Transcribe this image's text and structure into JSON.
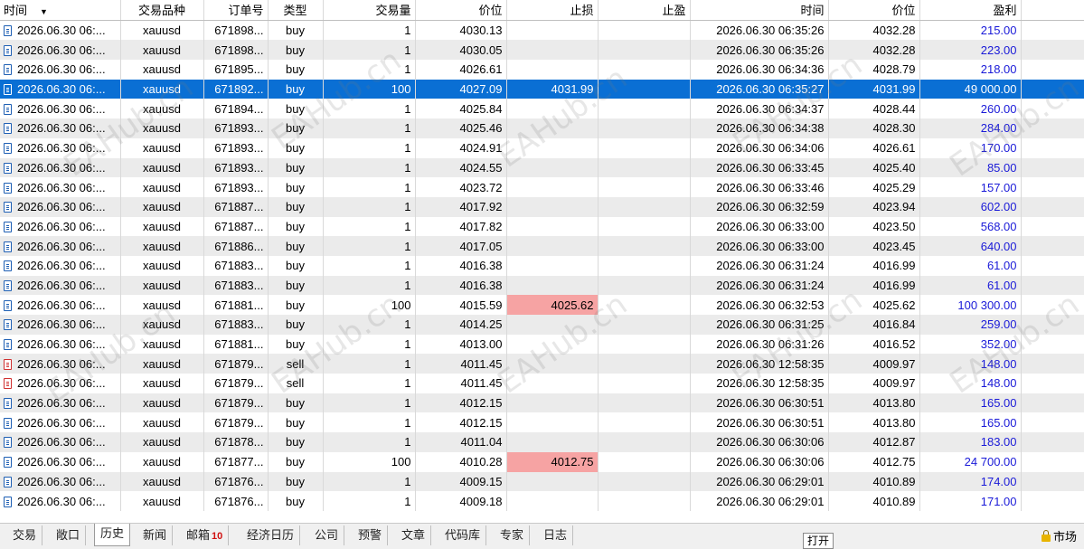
{
  "columns": [
    "时间",
    "交易品种",
    "订单号",
    "类型",
    "交易量",
    "价位",
    "止损",
    "止盈",
    "时间",
    "价位",
    "盈利"
  ],
  "rows": [
    {
      "open_time": "2026.06.30 06:...",
      "symbol": "xauusd",
      "order": "671898...",
      "type": "buy",
      "volume": "1",
      "price": "4030.13",
      "sl": "",
      "tp": "",
      "close_time": "2026.06.30 06:35:26",
      "close_price": "4032.28",
      "profit": "215.00"
    },
    {
      "open_time": "2026.06.30 06:...",
      "symbol": "xauusd",
      "order": "671898...",
      "type": "buy",
      "volume": "1",
      "price": "4030.05",
      "sl": "",
      "tp": "",
      "close_time": "2026.06.30 06:35:26",
      "close_price": "4032.28",
      "profit": "223.00"
    },
    {
      "open_time": "2026.06.30 06:...",
      "symbol": "xauusd",
      "order": "671895...",
      "type": "buy",
      "volume": "1",
      "price": "4026.61",
      "sl": "",
      "tp": "",
      "close_time": "2026.06.30 06:34:36",
      "close_price": "4028.79",
      "profit": "218.00"
    },
    {
      "open_time": "2026.06.30 06:...",
      "symbol": "xauusd",
      "order": "671892...",
      "type": "buy",
      "volume": "100",
      "price": "4027.09",
      "sl": "4031.99",
      "tp": "",
      "close_time": "2026.06.30 06:35:27",
      "close_price": "4031.99",
      "profit": "49 000.00",
      "selected": true
    },
    {
      "open_time": "2026.06.30 06:...",
      "symbol": "xauusd",
      "order": "671894...",
      "type": "buy",
      "volume": "1",
      "price": "4025.84",
      "sl": "",
      "tp": "",
      "close_time": "2026.06.30 06:34:37",
      "close_price": "4028.44",
      "profit": "260.00"
    },
    {
      "open_time": "2026.06.30 06:...",
      "symbol": "xauusd",
      "order": "671893...",
      "type": "buy",
      "volume": "1",
      "price": "4025.46",
      "sl": "",
      "tp": "",
      "close_time": "2026.06.30 06:34:38",
      "close_price": "4028.30",
      "profit": "284.00"
    },
    {
      "open_time": "2026.06.30 06:...",
      "symbol": "xauusd",
      "order": "671893...",
      "type": "buy",
      "volume": "1",
      "price": "4024.91",
      "sl": "",
      "tp": "",
      "close_time": "2026.06.30 06:34:06",
      "close_price": "4026.61",
      "profit": "170.00"
    },
    {
      "open_time": "2026.06.30 06:...",
      "symbol": "xauusd",
      "order": "671893...",
      "type": "buy",
      "volume": "1",
      "price": "4024.55",
      "sl": "",
      "tp": "",
      "close_time": "2026.06.30 06:33:45",
      "close_price": "4025.40",
      "profit": "85.00"
    },
    {
      "open_time": "2026.06.30 06:...",
      "symbol": "xauusd",
      "order": "671893...",
      "type": "buy",
      "volume": "1",
      "price": "4023.72",
      "sl": "",
      "tp": "",
      "close_time": "2026.06.30 06:33:46",
      "close_price": "4025.29",
      "profit": "157.00"
    },
    {
      "open_time": "2026.06.30 06:...",
      "symbol": "xauusd",
      "order": "671887...",
      "type": "buy",
      "volume": "1",
      "price": "4017.92",
      "sl": "",
      "tp": "",
      "close_time": "2026.06.30 06:32:59",
      "close_price": "4023.94",
      "profit": "602.00"
    },
    {
      "open_time": "2026.06.30 06:...",
      "symbol": "xauusd",
      "order": "671887...",
      "type": "buy",
      "volume": "1",
      "price": "4017.82",
      "sl": "",
      "tp": "",
      "close_time": "2026.06.30 06:33:00",
      "close_price": "4023.50",
      "profit": "568.00"
    },
    {
      "open_time": "2026.06.30 06:...",
      "symbol": "xauusd",
      "order": "671886...",
      "type": "buy",
      "volume": "1",
      "price": "4017.05",
      "sl": "",
      "tp": "",
      "close_time": "2026.06.30 06:33:00",
      "close_price": "4023.45",
      "profit": "640.00"
    },
    {
      "open_time": "2026.06.30 06:...",
      "symbol": "xauusd",
      "order": "671883...",
      "type": "buy",
      "volume": "1",
      "price": "4016.38",
      "sl": "",
      "tp": "",
      "close_time": "2026.06.30 06:31:24",
      "close_price": "4016.99",
      "profit": "61.00"
    },
    {
      "open_time": "2026.06.30 06:...",
      "symbol": "xauusd",
      "order": "671883...",
      "type": "buy",
      "volume": "1",
      "price": "4016.38",
      "sl": "",
      "tp": "",
      "close_time": "2026.06.30 06:31:24",
      "close_price": "4016.99",
      "profit": "61.00"
    },
    {
      "open_time": "2026.06.30 06:...",
      "symbol": "xauusd",
      "order": "671881...",
      "type": "buy",
      "volume": "100",
      "price": "4015.59",
      "sl": "4025.62",
      "sl_highlight": true,
      "tp": "",
      "close_time": "2026.06.30 06:32:53",
      "close_price": "4025.62",
      "profit": "100 300.00"
    },
    {
      "open_time": "2026.06.30 06:...",
      "symbol": "xauusd",
      "order": "671883...",
      "type": "buy",
      "volume": "1",
      "price": "4014.25",
      "sl": "",
      "tp": "",
      "close_time": "2026.06.30 06:31:25",
      "close_price": "4016.84",
      "profit": "259.00"
    },
    {
      "open_time": "2026.06.30 06:...",
      "symbol": "xauusd",
      "order": "671881...",
      "type": "buy",
      "volume": "1",
      "price": "4013.00",
      "sl": "",
      "tp": "",
      "close_time": "2026.06.30 06:31:26",
      "close_price": "4016.52",
      "profit": "352.00"
    },
    {
      "open_time": "2026.06.30 06:...",
      "symbol": "xauusd",
      "order": "671879...",
      "type": "sell",
      "volume": "1",
      "price": "4011.45",
      "sl": "",
      "tp": "",
      "close_time": "2026.06.30 12:58:35",
      "close_price": "4009.97",
      "profit": "148.00"
    },
    {
      "open_time": "2026.06.30 06:...",
      "symbol": "xauusd",
      "order": "671879...",
      "type": "sell",
      "volume": "1",
      "price": "4011.45",
      "sl": "",
      "tp": "",
      "close_time": "2026.06.30 12:58:35",
      "close_price": "4009.97",
      "profit": "148.00"
    },
    {
      "open_time": "2026.06.30 06:...",
      "symbol": "xauusd",
      "order": "671879...",
      "type": "buy",
      "volume": "1",
      "price": "4012.15",
      "sl": "",
      "tp": "",
      "close_time": "2026.06.30 06:30:51",
      "close_price": "4013.80",
      "profit": "165.00"
    },
    {
      "open_time": "2026.06.30 06:...",
      "symbol": "xauusd",
      "order": "671879...",
      "type": "buy",
      "volume": "1",
      "price": "4012.15",
      "sl": "",
      "tp": "",
      "close_time": "2026.06.30 06:30:51",
      "close_price": "4013.80",
      "profit": "165.00"
    },
    {
      "open_time": "2026.06.30 06:...",
      "symbol": "xauusd",
      "order": "671878...",
      "type": "buy",
      "volume": "1",
      "price": "4011.04",
      "sl": "",
      "tp": "",
      "close_time": "2026.06.30 06:30:06",
      "close_price": "4012.87",
      "profit": "183.00"
    },
    {
      "open_time": "2026.06.30 06:...",
      "symbol": "xauusd",
      "order": "671877...",
      "type": "buy",
      "volume": "100",
      "price": "4010.28",
      "sl": "4012.75",
      "sl_highlight": true,
      "tp": "",
      "close_time": "2026.06.30 06:30:06",
      "close_price": "4012.75",
      "profit": "24 700.00"
    },
    {
      "open_time": "2026.06.30 06:...",
      "symbol": "xauusd",
      "order": "671876...",
      "type": "buy",
      "volume": "1",
      "price": "4009.15",
      "sl": "",
      "tp": "",
      "close_time": "2026.06.30 06:29:01",
      "close_price": "4010.89",
      "profit": "174.00"
    },
    {
      "open_time": "2026.06.30 06:...",
      "symbol": "xauusd",
      "order": "671876...",
      "type": "buy",
      "volume": "1",
      "price": "4009.18",
      "sl": "",
      "tp": "",
      "close_time": "2026.06.30 06:29:01",
      "close_price": "4010.89",
      "profit": "171.00"
    }
  ],
  "tabs": [
    {
      "label": "交易"
    },
    {
      "label": "敞口"
    },
    {
      "label": "历史",
      "active": true
    },
    {
      "label": "新闻"
    },
    {
      "label": "邮箱",
      "badge": "10"
    },
    {
      "label": "经济日历"
    },
    {
      "label": "公司"
    },
    {
      "label": "预警"
    },
    {
      "label": "文章"
    },
    {
      "label": "代码库"
    },
    {
      "label": "专家"
    },
    {
      "label": "日志"
    }
  ],
  "tooltip": "打开",
  "market_label": "市场",
  "watermark": "EAHub.cn",
  "colors": {
    "selected_row": "#0a6fd4",
    "profit_text": "#1a1ad8",
    "sl_highlight": "#f6a3a3",
    "alt_row": "#ebebeb"
  }
}
